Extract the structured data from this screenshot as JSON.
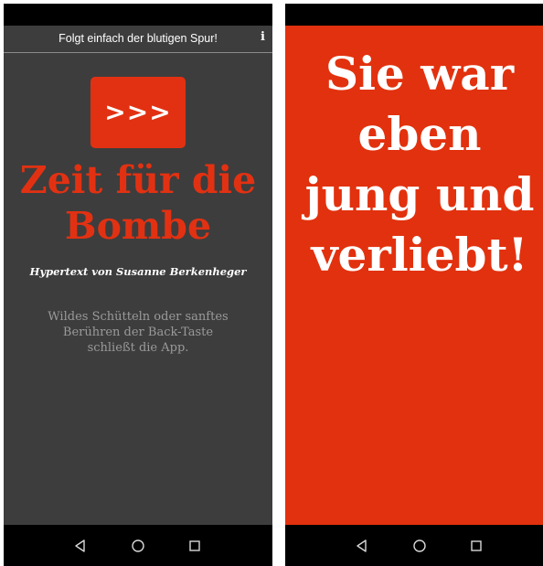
{
  "left_screen": {
    "app_bar": {
      "title": "Folgt einfach der blutigen Spur!",
      "info_label": "i"
    },
    "start_button_label": ">>>",
    "title_lines": [
      "Zeit für die",
      "Bombe"
    ],
    "byline": "Hypertext von Susanne Berkenheger",
    "instructions_lines": [
      "Wildes Schütteln oder sanftes",
      "Berühren der Back-Taste",
      "schließt die App."
    ]
  },
  "right_screen": {
    "story_lines": [
      "Sie war",
      "eben",
      "jung und",
      "verliebt!"
    ]
  },
  "navigation": {
    "icons": [
      "back-icon",
      "home-icon",
      "recents-icon"
    ]
  },
  "colors": {
    "accent_red": "#e23112",
    "app_background": "#3d3d3d",
    "instruction_text": "#9a9a9a"
  }
}
